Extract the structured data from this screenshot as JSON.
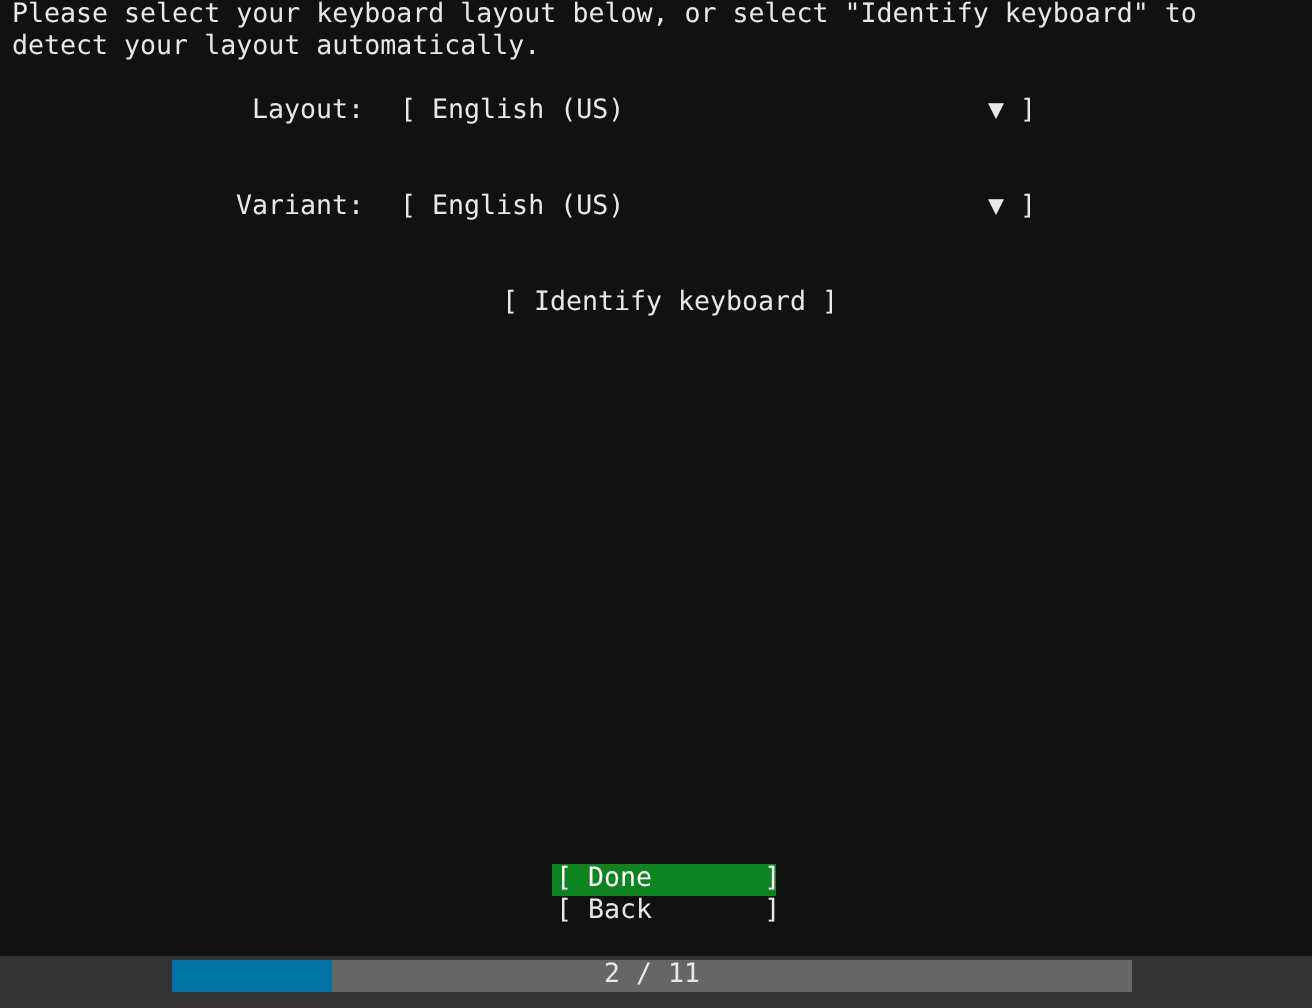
{
  "instructions": "Please select your keyboard layout below, or select \"Identify keyboard\" to detect your layout automatically.",
  "fields": [
    {
      "label": "Layout:",
      "open": "[",
      "value": "English (US)",
      "arrow": "▼",
      "close": "]"
    },
    {
      "label": "Variant:",
      "open": "[",
      "value": "English (US)",
      "arrow": "▼",
      "close": "]"
    }
  ],
  "identify_button": "[ Identify keyboard ]",
  "buttons": [
    {
      "label": "[ Done       ]",
      "selected": true
    },
    {
      "label": "[ Back       ]",
      "selected": false
    }
  ],
  "progress": {
    "level": 0.167,
    "text": "2 / 11"
  }
}
